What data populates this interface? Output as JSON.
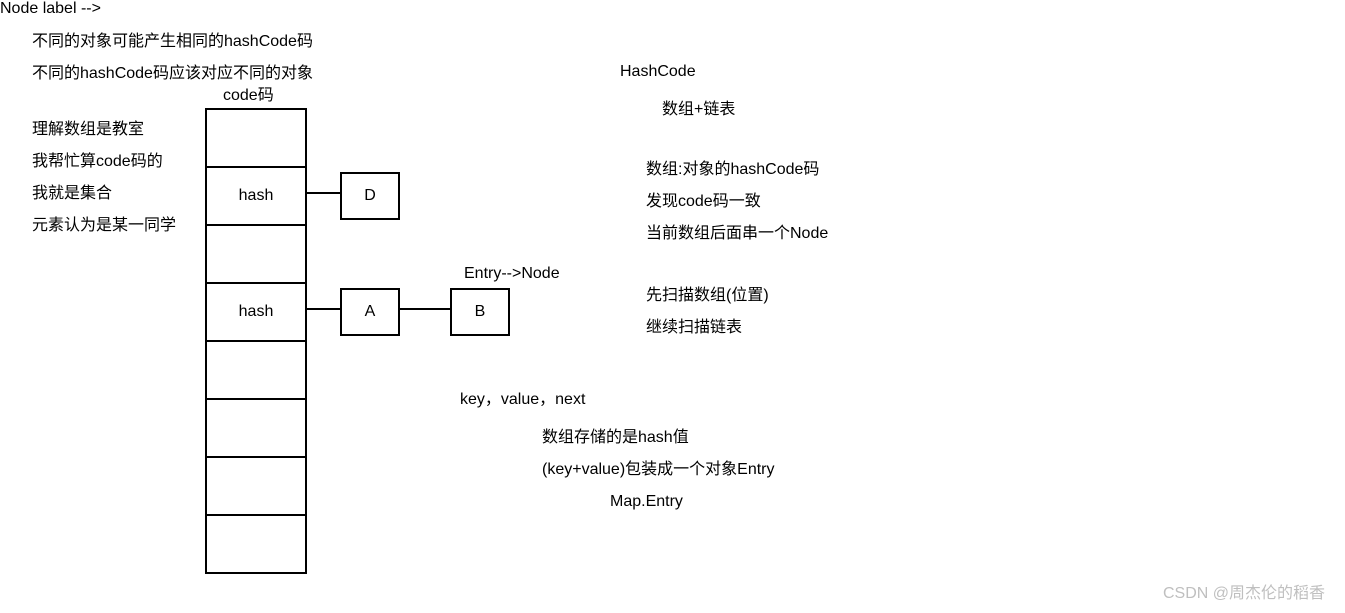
{
  "headerLines": {
    "l1": "不同的对象可能产生相同的hashCode码",
    "l2": "不同的hashCode码应该对应不同的对象"
  },
  "arrayLabel": "code码",
  "leftNotes": {
    "n1": "理解数组是教室",
    "n2": "我帮忙算code码的",
    "n3": "我就是集合",
    "n4": "元素认为是某一同学"
  },
  "cells": {
    "c0": "",
    "c1": "hash",
    "c2": "",
    "c3": "hash",
    "c4": "",
    "c5": "",
    "c6": "",
    "c7": ""
  },
  "nodes": {
    "d": "D",
    "a": "A",
    "b": "B"
  },
  "entryLabel": "Entry-->Node",
  "center": {
    "kvn": "key，value，next",
    "s1": "数组存储的是hash值",
    "s2": "(key+value)包装成一个对象Entry",
    "s3": "Map.Entry"
  },
  "right": {
    "title": "HashCode",
    "r1": "数组+链表",
    "r2": "数组:对象的hashCode码",
    "r3": "发现code码一致",
    "r4": "当前数组后面串一个Node",
    "r5": "先扫描数组(位置)",
    "r6": "继续扫描链表"
  },
  "watermark": "CSDN @周杰伦的稻香"
}
